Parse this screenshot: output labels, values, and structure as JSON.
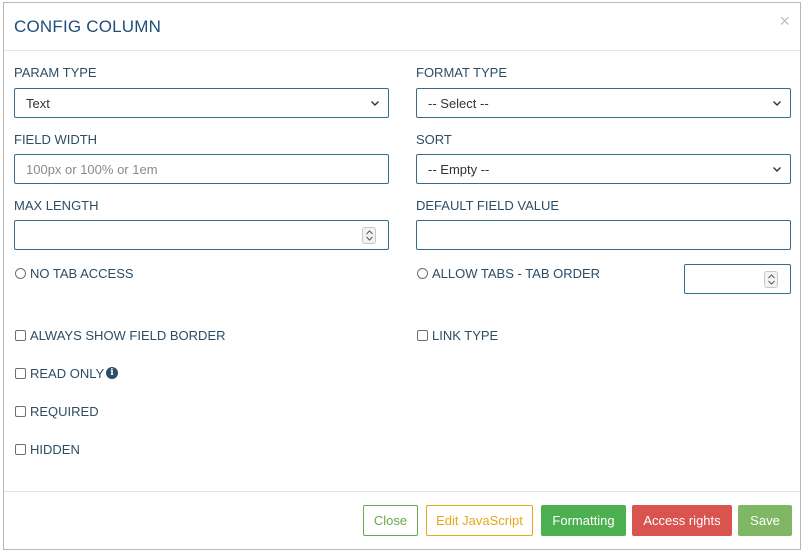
{
  "modal": {
    "title": "CONFIG COLUMN",
    "close_symbol": "×"
  },
  "fields": {
    "param_type": {
      "label": "PARAM TYPE",
      "value": "Text"
    },
    "format_type": {
      "label": "FORMAT TYPE",
      "value": "-- Select --"
    },
    "field_width": {
      "label": "FIELD WIDTH",
      "placeholder": "100px or 100% or 1em",
      "value": ""
    },
    "sort": {
      "label": "SORT",
      "value": "-- Empty --"
    },
    "max_length": {
      "label": "MAX LENGTH",
      "value": ""
    },
    "default_field_value": {
      "label": "DEFAULT FIELD VALUE",
      "value": ""
    }
  },
  "options": {
    "no_tab_access": "NO TAB ACCESS",
    "allow_tabs": "ALLOW TABS - TAB ORDER",
    "always_show_border": "ALWAYS SHOW FIELD BORDER",
    "link_type": "LINK TYPE",
    "read_only": "READ ONLY",
    "required": "REQUIRED",
    "hidden": "HIDDEN"
  },
  "icons": {
    "info": "i"
  },
  "footer": {
    "close": "Close",
    "edit_js": "Edit JavaScript",
    "formatting": "Formatting",
    "access_rights": "Access rights",
    "save": "Save"
  },
  "colors": {
    "title": "#1f4e79",
    "label": "#2b4d66",
    "input_border": "#3a6b8c",
    "close_btn": "#6aa84f",
    "js_btn": "#e6a817",
    "formatting_btn": "#4caf50",
    "access_btn": "#d9534f",
    "save_btn": "#7fb765"
  }
}
